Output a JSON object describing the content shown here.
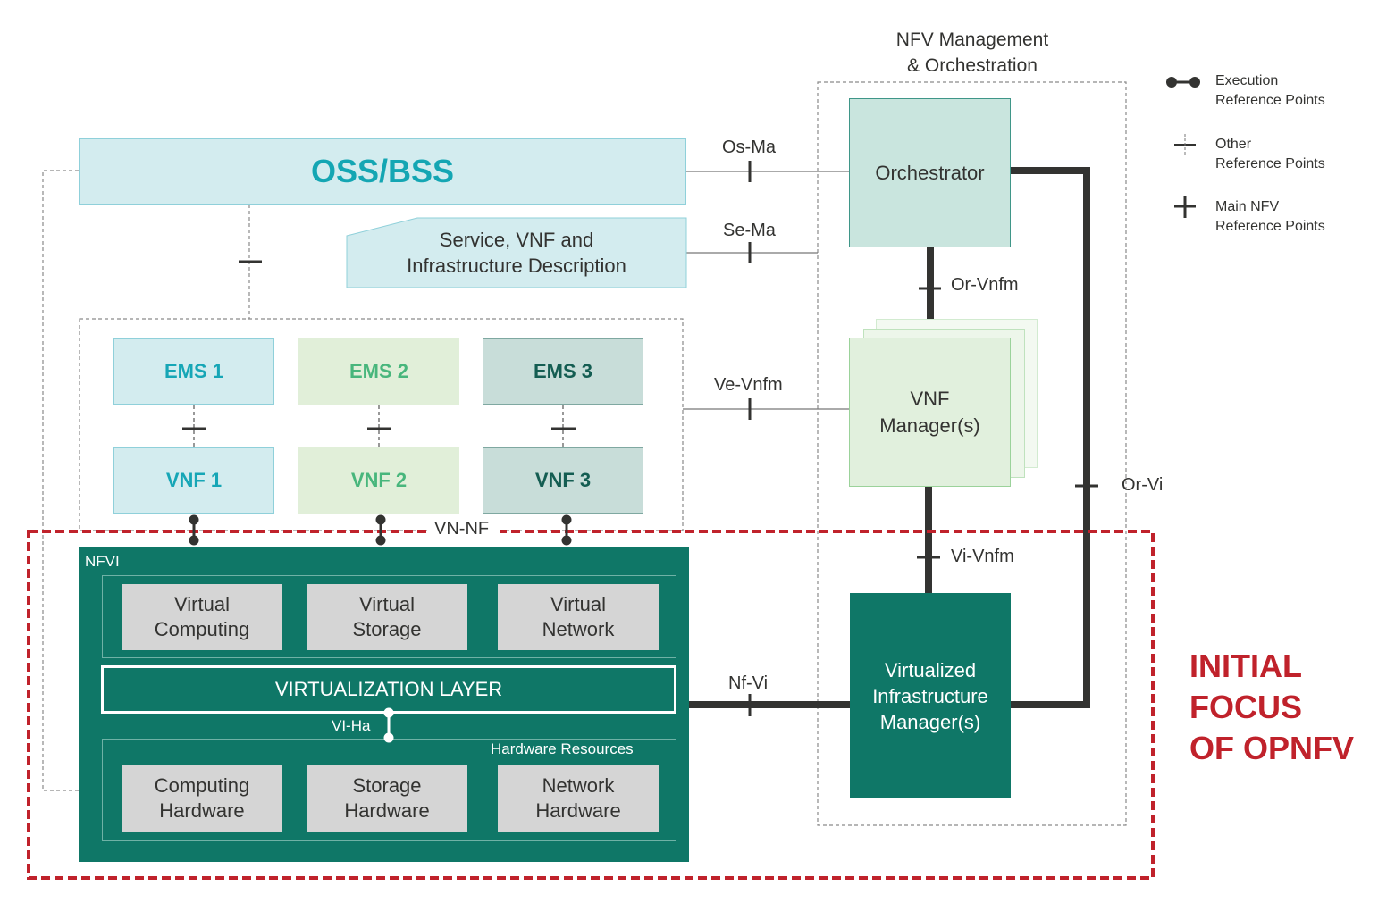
{
  "colors": {
    "nfvi_green": "#0f7767",
    "focus_red": "#c0222b",
    "oss_teal": "#14a6b3",
    "line_dark": "#333331"
  },
  "mano": {
    "title_line1": "NFV Management",
    "title_line2": "& Orchestration",
    "orchestrator": "Orchestrator",
    "vnf_manager_line1": "VNF",
    "vnf_manager_line2": "Manager(s)",
    "vim_line1": "Virtualized",
    "vim_line2": "Infrastructure",
    "vim_line3": "Manager(s)"
  },
  "oss_bss": "OSS/BSS",
  "description": {
    "line1": "Service, VNF and",
    "line2": "Infrastructure Description"
  },
  "ems": [
    "EMS 1",
    "EMS 2",
    "EMS 3"
  ],
  "vnfs": [
    "VNF 1",
    "VNF 2",
    "VNF 3"
  ],
  "nfvi": {
    "title": "NFVI",
    "virtual": [
      {
        "line1": "Virtual",
        "line2": "Computing"
      },
      {
        "line1": "Virtual",
        "line2": "Storage"
      },
      {
        "line1": "Virtual",
        "line2": "Network"
      }
    ],
    "virtualization_layer": "VIRTUALIZATION LAYER",
    "hardware_title": "Hardware Resources",
    "hardware": [
      {
        "line1": "Computing",
        "line2": "Hardware"
      },
      {
        "line1": "Storage",
        "line2": "Hardware"
      },
      {
        "line1": "Network",
        "line2": "Hardware"
      }
    ]
  },
  "reference_points": {
    "os_ma": "Os-Ma",
    "se_ma": "Se-Ma",
    "ve_vnfm": "Ve-Vnfm",
    "or_vnfm": "Or-Vnfm",
    "vi_vnfm": "Vi-Vnfm",
    "or_vi": "Or-Vi",
    "nf_vi": "Nf-Vi",
    "vn_nf": "VN-NF",
    "vi_ha": "VI-Ha"
  },
  "legend": [
    {
      "icon": "execution-reference-point-icon",
      "line1": "Execution",
      "line2": "Reference Points"
    },
    {
      "icon": "other-reference-point-icon",
      "line1": "Other",
      "line2": "Reference Points"
    },
    {
      "icon": "main-reference-point-icon",
      "line1": "Main NFV",
      "line2": "Reference Points"
    }
  ],
  "focus_label": {
    "line1": "INITIAL",
    "line2": "FOCUS",
    "line3": "OF OPNFV"
  }
}
